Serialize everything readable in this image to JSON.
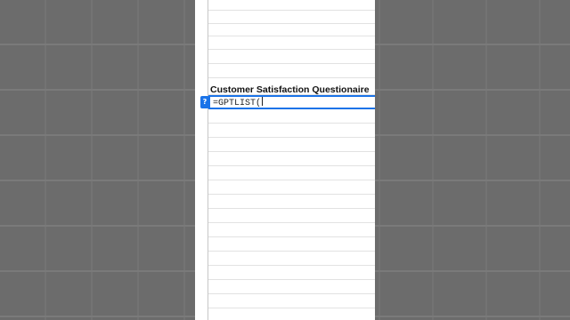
{
  "sheet": {
    "title_cell": "Customer Satisfaction Questionaire",
    "active_cell": {
      "formula": "=GPTLIST("
    },
    "help_badge": {
      "glyph": "?",
      "icon": "help-icon",
      "color": "#1a73e8"
    }
  },
  "colors": {
    "selection": "#1a73e8",
    "backdrop": "#6c6c6c",
    "gridline": "#e2e2e2"
  }
}
